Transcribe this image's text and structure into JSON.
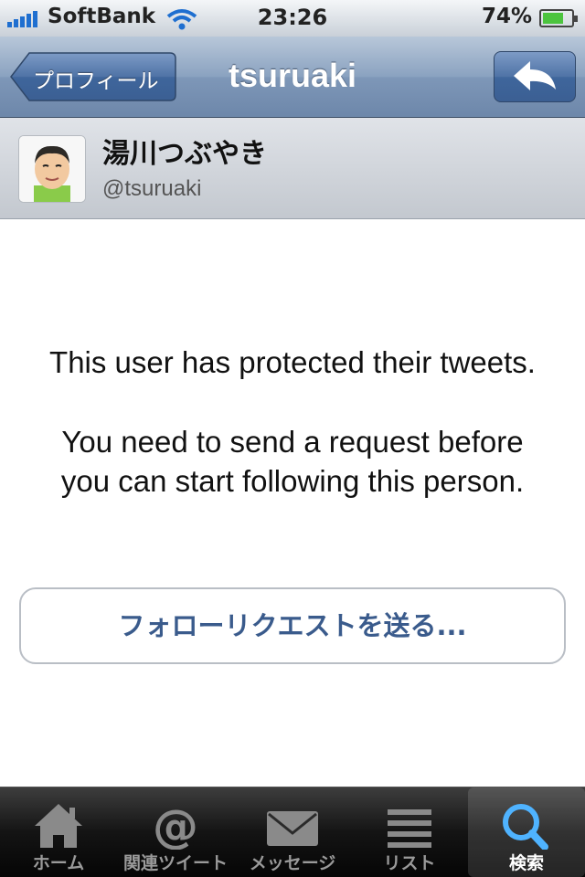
{
  "status_bar": {
    "carrier": "SoftBank",
    "time": "23:26",
    "battery": "74%",
    "battery_level": 0.74
  },
  "nav": {
    "back_label": "プロフィール",
    "title": "tsuruaki",
    "reply_icon": "reply-arrow-icon"
  },
  "profile": {
    "name": "湯川つぶやき",
    "handle": "@tsuruaki"
  },
  "content": {
    "line1": "This user has protected their tweets.",
    "line2": "You need to send a request before",
    "line3": "you can start following this person.",
    "button_label": "フォローリクエストを送る..."
  },
  "tabs": [
    {
      "label": "ホーム",
      "icon": "home-icon",
      "active": false
    },
    {
      "label": "関連ツイート",
      "icon": "at-icon",
      "active": false
    },
    {
      "label": "メッセージ",
      "icon": "envelope-icon",
      "active": false
    },
    {
      "label": "リスト",
      "icon": "list-icon",
      "active": false
    },
    {
      "label": "検索",
      "icon": "search-icon",
      "active": true
    }
  ],
  "colors": {
    "nav_blue": "#7e97b8",
    "button_text": "#3a5b8c",
    "battery_green": "#4cc43f",
    "active_icon": "#4fb3ff"
  }
}
